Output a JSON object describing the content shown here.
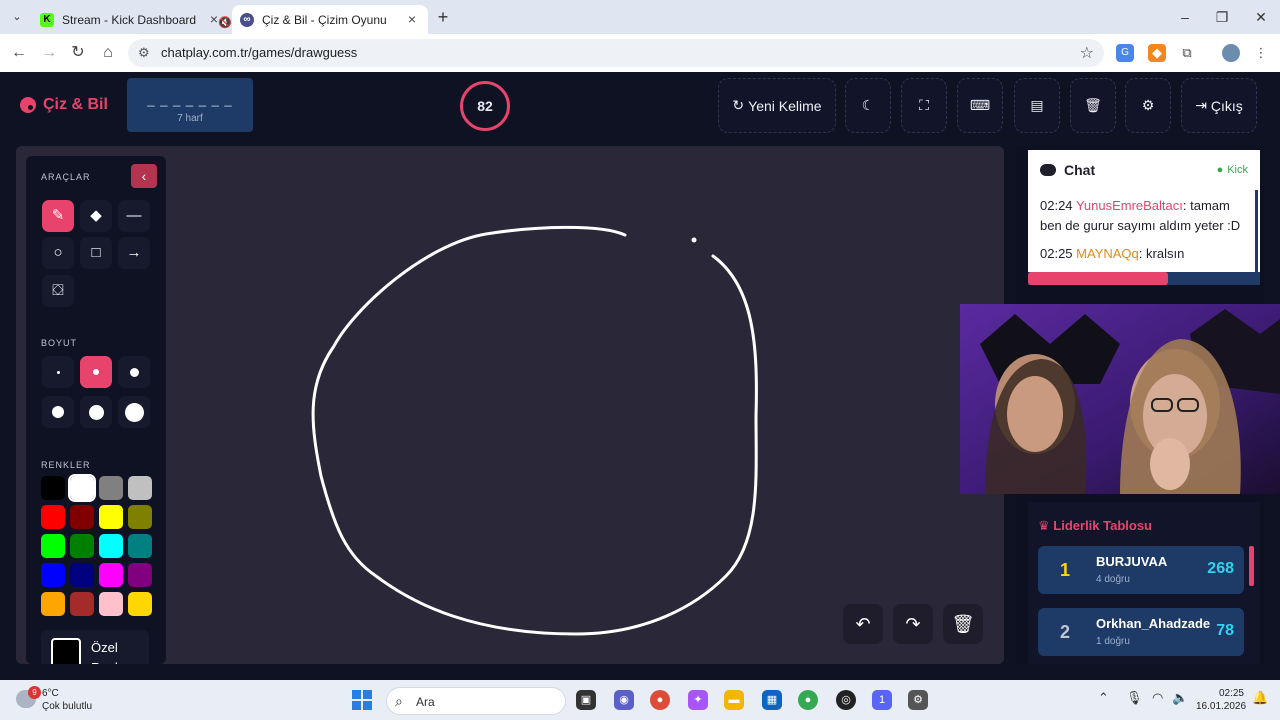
{
  "browser": {
    "tabs": [
      {
        "title": "Stream - Kick Dashboard",
        "favicon_letter": "K"
      },
      {
        "title": "Çiz & Bil - Çizim Oyunu",
        "favicon_letter": "∞"
      }
    ],
    "url": "chatplay.com.tr/games/drawguess"
  },
  "header": {
    "logo": "Çiz & Bil",
    "word_dashes": "_ _ _ _ _ _ _",
    "word_hint": "7 harf",
    "timer": "82",
    "buttons": {
      "new_word": "Yeni Kelime",
      "logout": "Çıkış"
    }
  },
  "tools": {
    "section_tools": "ARAÇLAR",
    "section_size": "BOYUT",
    "section_colors": "RENKLER",
    "custom_color_label": "Özel Renk",
    "palette": [
      "#000000",
      "#ffffff",
      "#808080",
      "#c0c0c0",
      "#ff0000",
      "#800000",
      "#ffff00",
      "#808000",
      "#00ff00",
      "#008000",
      "#00ffff",
      "#008080",
      "#0000ff",
      "#000080",
      "#ff00ff",
      "#800080",
      "#ffa500",
      "#a52a2a",
      "#ffc0cb",
      "#ffd700"
    ]
  },
  "chat": {
    "title": "Chat",
    "platform": "Kick",
    "messages": [
      {
        "time": "02:24",
        "user": "YunusEmreBaltacı",
        "text": ": tamam ben de gurur sayımı aldım yeter :D"
      },
      {
        "time": "02:25",
        "user": "MAYNAQq",
        "text": ": kralsın"
      }
    ]
  },
  "leaderboard": {
    "title": "Liderlik Tablosu",
    "rows": [
      {
        "rank": "1",
        "name": "BURJUVAA",
        "correct": "4 doğru",
        "points": "268",
        "rank_color": "#ffd60a"
      },
      {
        "rank": "2",
        "name": "Orkhan_Ahadzade",
        "correct": "1 doğru",
        "points": "78",
        "rank_color": "#c0c6d4"
      }
    ]
  },
  "taskbar": {
    "weather_temp": "6°C",
    "weather_desc": "Çok bulutlu",
    "weather_badge": "9",
    "search_placeholder": "Ara",
    "discord_badge": "1",
    "time": "02:25",
    "date": "16.01.2026"
  },
  "colors": {
    "accent": "#e8436c",
    "app_bg": "#0f1222",
    "canvas_bg": "#292738",
    "word_box": "#1e3a66"
  }
}
